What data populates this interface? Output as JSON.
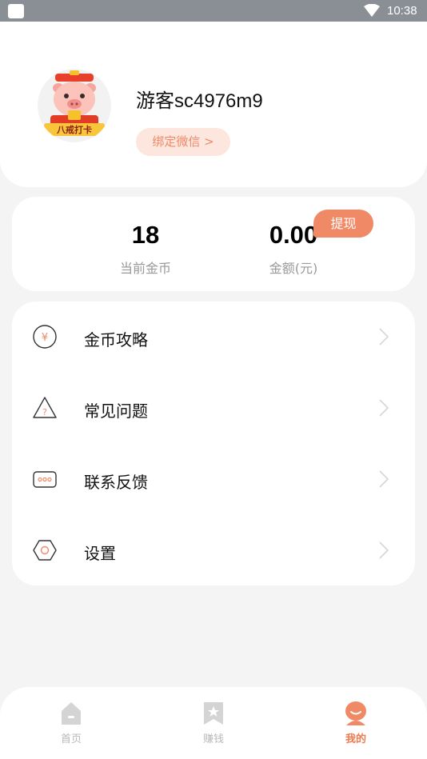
{
  "status_bar": {
    "time": "10:38"
  },
  "profile": {
    "username": "游客sc4976m9",
    "bind_label": "绑定微信 >",
    "avatar_banner_text": "八戒打卡"
  },
  "stats": {
    "coins_value": "18",
    "coins_label": "当前金币",
    "amount_value": "0.00",
    "amount_label": "金额(元)",
    "withdraw_label": "提现"
  },
  "menu": {
    "items": [
      {
        "label": "金币攻略",
        "icon": "yuan-coin-icon"
      },
      {
        "label": "常见问题",
        "icon": "question-icon"
      },
      {
        "label": "联系反馈",
        "icon": "feedback-chat-icon"
      },
      {
        "label": "设置",
        "icon": "settings-hexagon-icon"
      }
    ]
  },
  "nav": {
    "items": [
      {
        "label": "首页",
        "icon": "home-icon",
        "active": false
      },
      {
        "label": "赚钱",
        "icon": "bookmark-star-icon",
        "active": false
      },
      {
        "label": "我的",
        "icon": "user-icon",
        "active": true
      }
    ]
  },
  "colors": {
    "accent": "#f08a66",
    "accent_light": "#fde6dd",
    "status_bar": "#8a8f96",
    "background": "#f4f4f4"
  }
}
